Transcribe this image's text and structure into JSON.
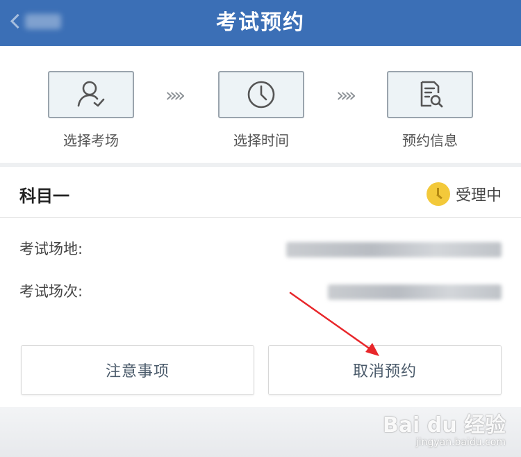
{
  "header": {
    "title": "考试预约",
    "back_icon": "chevron-left-icon"
  },
  "steps": [
    {
      "label": "选择考场",
      "icon": "user-check-icon"
    },
    {
      "label": "选择时间",
      "icon": "clock-icon"
    },
    {
      "label": "预约信息",
      "icon": "document-search-icon"
    }
  ],
  "step_separator": "»",
  "card": {
    "subject": "科目一",
    "status": {
      "text": "受理中",
      "icon": "clock-status-icon",
      "color": "#f3c93a"
    },
    "fields": [
      {
        "label": "考试场地:"
      },
      {
        "label": "考试场次:"
      }
    ],
    "buttons": {
      "notes": "注意事项",
      "cancel": "取消预约"
    }
  },
  "annotation": {
    "color": "#e8262a"
  },
  "watermark": {
    "main": "Bai du 经验",
    "sub": "jingyan.baidu.com"
  },
  "colors": {
    "header_bg": "#3b6fb6",
    "step_box_bg": "#edf3f6",
    "step_border": "#9aa4ad"
  }
}
